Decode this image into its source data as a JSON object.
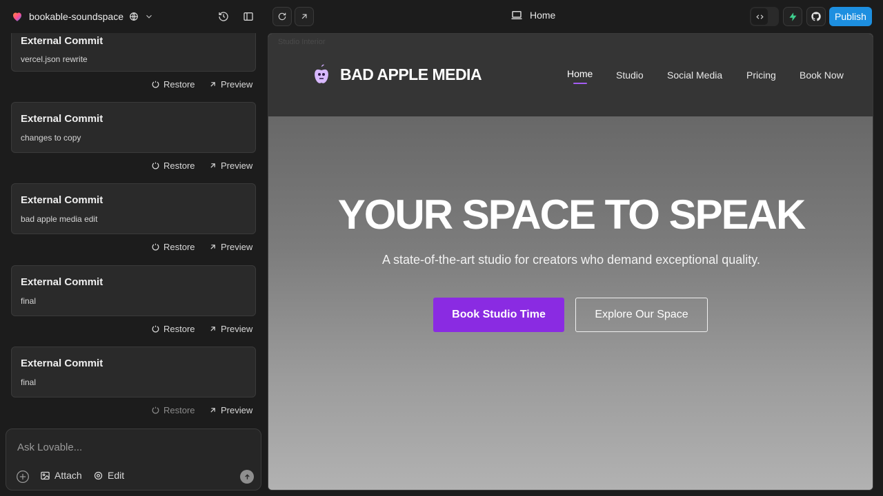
{
  "project": {
    "name": "bookable-soundspace"
  },
  "preview_bar": {
    "page": "Home"
  },
  "header_actions": {
    "publish_label": "Publish"
  },
  "commits": [
    {
      "title": "External Commit",
      "message": "vercel.json rewrite",
      "restore": "Restore",
      "preview": "Preview",
      "restore_disabled": false
    },
    {
      "title": "External Commit",
      "message": "changes to copy",
      "restore": "Restore",
      "preview": "Preview",
      "restore_disabled": false
    },
    {
      "title": "External Commit",
      "message": "bad apple media edit",
      "restore": "Restore",
      "preview": "Preview",
      "restore_disabled": false
    },
    {
      "title": "External Commit",
      "message": "final",
      "restore": "Restore",
      "preview": "Preview",
      "restore_disabled": false
    },
    {
      "title": "External Commit",
      "message": "final",
      "restore": "Restore",
      "preview": "Preview",
      "restore_disabled": true
    }
  ],
  "chat": {
    "placeholder": "Ask Lovable...",
    "attach_label": "Attach",
    "edit_label": "Edit"
  },
  "site": {
    "image_alt": "Studio Interior",
    "brand": "BAD APPLE MEDIA",
    "nav": [
      "Home",
      "Studio",
      "Social Media",
      "Pricing",
      "Book Now"
    ],
    "active_nav": "Home",
    "hero_title": "YOUR SPACE TO SPEAK",
    "hero_subtitle": "A state-of-the-art studio for creators who demand exceptional quality.",
    "primary_cta": "Book Studio Time",
    "secondary_cta": "Explore Our Space",
    "accent_color": "#8a2be2"
  },
  "colors": {
    "publish": "#1d8fe0",
    "supabase": "#3ecf8e"
  }
}
